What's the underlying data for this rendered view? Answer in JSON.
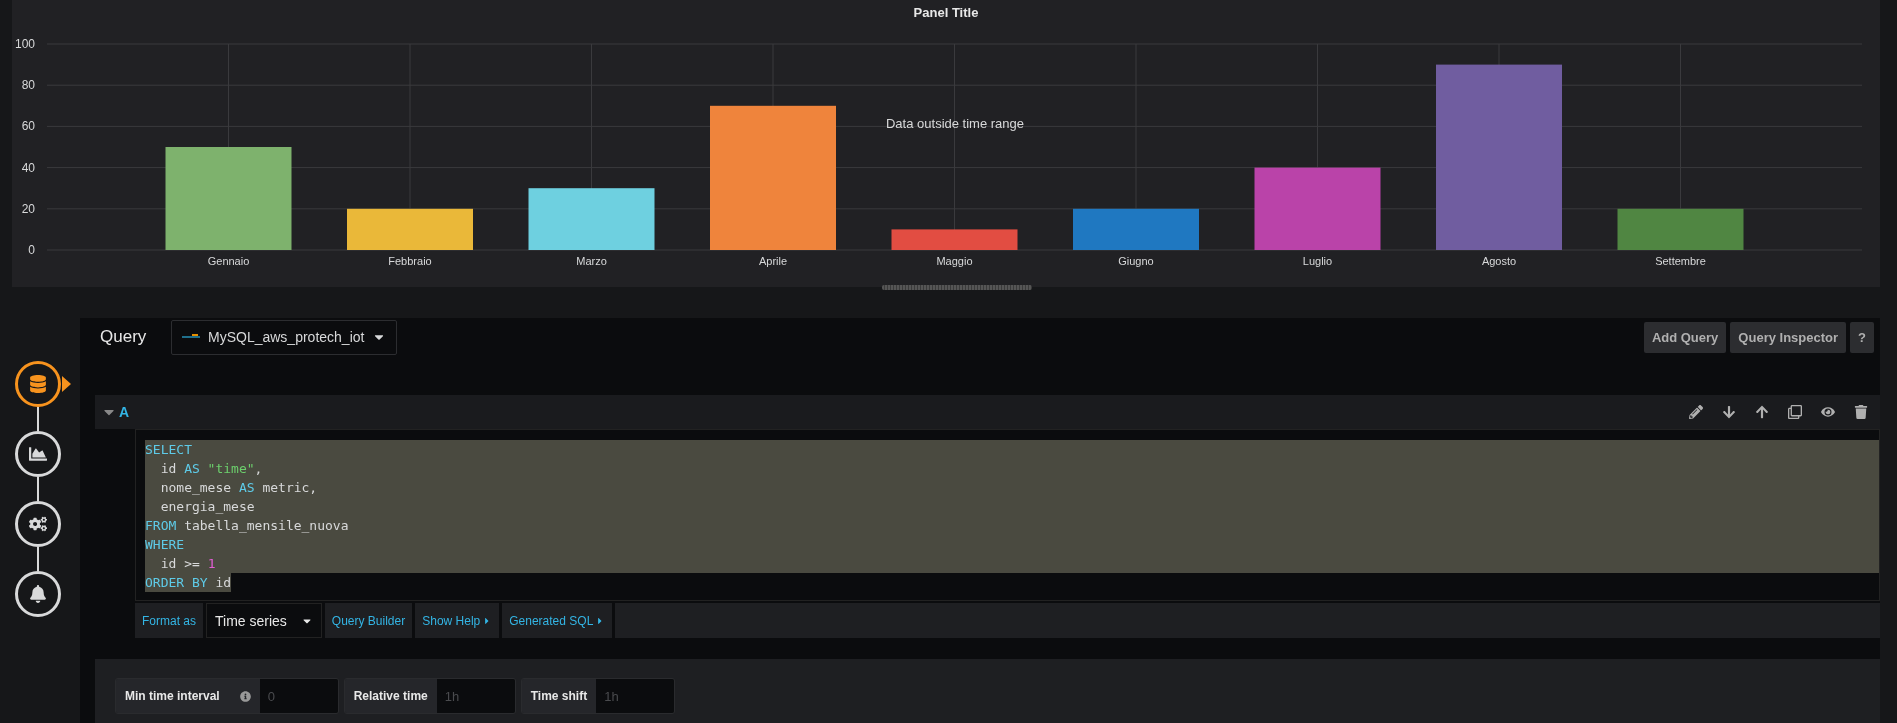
{
  "panel": {
    "title": "Panel Title",
    "message": "Data outside time range",
    "chart_data": {
      "type": "bar",
      "ylim": [
        0,
        100
      ],
      "yticks": [
        0,
        20,
        40,
        60,
        80,
        100
      ],
      "grid": true,
      "series": [
        {
          "name": "Gennaio",
          "color": "#7eb26d",
          "values": [
            50,
            null,
            null,
            null,
            null,
            null,
            null,
            null,
            null
          ]
        },
        {
          "name": "Febbraio",
          "color": "#eab839",
          "values": [
            null,
            20,
            null,
            null,
            null,
            null,
            null,
            null,
            null
          ]
        },
        {
          "name": "Marzo",
          "color": "#6ed0e0",
          "values": [
            null,
            null,
            30,
            null,
            null,
            null,
            null,
            null,
            null
          ]
        },
        {
          "name": "Aprile",
          "color": "#ef843c",
          "values": [
            null,
            null,
            null,
            70,
            null,
            null,
            null,
            null,
            null
          ]
        },
        {
          "name": "Maggio",
          "color": "#e24d42",
          "values": [
            null,
            null,
            null,
            null,
            10,
            null,
            null,
            null,
            null
          ]
        },
        {
          "name": "Giugno",
          "color": "#1f78c1",
          "values": [
            null,
            null,
            null,
            null,
            null,
            20,
            null,
            null,
            null
          ]
        },
        {
          "name": "Luglio",
          "color": "#ba43a9",
          "values": [
            null,
            null,
            null,
            null,
            null,
            null,
            40,
            null,
            null
          ]
        },
        {
          "name": "Agosto",
          "color": "#705da0",
          "values": [
            null,
            null,
            null,
            null,
            null,
            null,
            null,
            90,
            null
          ]
        },
        {
          "name": "Settembre",
          "color": "#508642",
          "values": [
            null,
            null,
            null,
            null,
            null,
            null,
            null,
            null,
            20
          ]
        }
      ]
    }
  },
  "query_editor": {
    "steps": [
      {
        "kind": "queries",
        "selected": true
      },
      {
        "kind": "visualization",
        "selected": false
      },
      {
        "kind": "settings",
        "selected": false
      },
      {
        "kind": "alert",
        "selected": false
      }
    ],
    "title": "Query",
    "datasource": {
      "name": "MySQL_aws_protech_iot"
    },
    "buttons": [
      "Add Query",
      "Query Inspector",
      "?"
    ],
    "queries": [
      {
        "ref_id": "A",
        "expanded": true,
        "sql_selected": true,
        "sql_lines": [
          [
            {
              "kind": "keyword",
              "text": "SELECT"
            }
          ],
          [
            {
              "kind": "plain",
              "text": "  id "
            },
            {
              "kind": "keyword",
              "text": "AS"
            },
            {
              "kind": "string",
              "text": " \"time\""
            },
            {
              "kind": "plain",
              "text": ","
            }
          ],
          [
            {
              "kind": "plain",
              "text": "  nome_mese "
            },
            {
              "kind": "keyword",
              "text": "AS"
            },
            {
              "kind": "plain",
              "text": " metric,"
            }
          ],
          [
            {
              "kind": "plain",
              "text": "  energia_mese"
            }
          ],
          [
            {
              "kind": "keyword",
              "text": "FROM"
            },
            {
              "kind": "plain",
              "text": " tabella_mensile_nuova"
            }
          ],
          [
            {
              "kind": "keyword",
              "text": "WHERE"
            }
          ],
          [
            {
              "kind": "plain",
              "text": "  id >= "
            },
            {
              "kind": "number",
              "text": "1"
            }
          ],
          [
            {
              "kind": "keyword",
              "text": "ORDER BY"
            },
            {
              "kind": "plain",
              "text": " id"
            }
          ]
        ],
        "format_label": "Format as",
        "format_value": "Time series",
        "tools": [
          {
            "label": "Query Builder",
            "kind": "button"
          },
          {
            "label": "Show Help",
            "kind": "toggle"
          },
          {
            "label": "Generated SQL",
            "kind": "toggle"
          }
        ]
      }
    ],
    "options": [
      {
        "label": "Min time interval",
        "info": true,
        "placeholder": "0"
      },
      {
        "label": "Relative time",
        "info": false,
        "placeholder": "1h"
      },
      {
        "label": "Time shift",
        "info": false,
        "placeholder": "1h"
      }
    ]
  }
}
